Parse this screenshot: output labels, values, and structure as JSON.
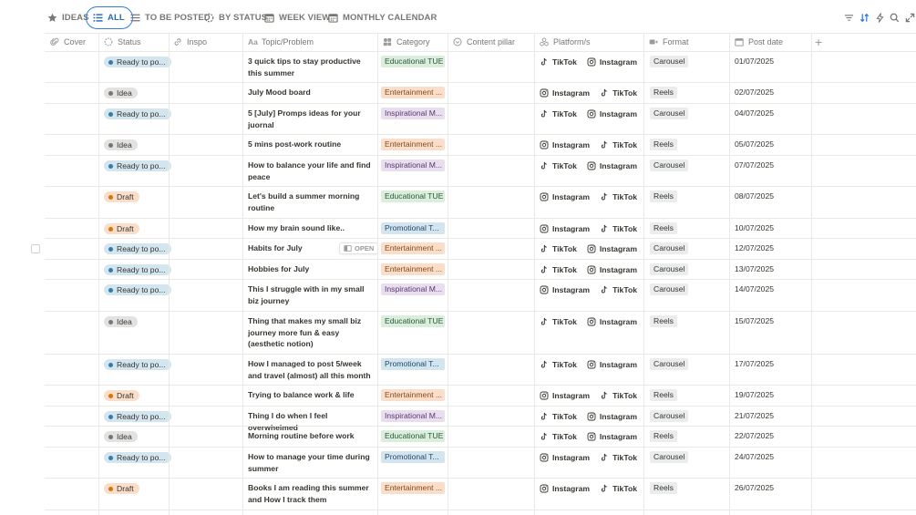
{
  "views": {
    "ideas": "IDEAS",
    "all": "ALL",
    "to_be_posted": "TO BE POSTED",
    "by_status": "BY STATUS",
    "week_view": "WEEK VIEW",
    "monthly_calendar": "MONTHLY CALENDAR"
  },
  "columns": {
    "cover": "Cover",
    "status": "Status",
    "inspo": "Inspo",
    "topic": "Topic/Problem",
    "category": "Category",
    "pillar": "Content pillar",
    "platforms": "Platform/s",
    "format": "Format",
    "post_date": "Post date"
  },
  "row_action": "OPEN",
  "colors": {
    "accent": "#2f80d8",
    "status_ready_bg": "#d3e5ef",
    "status_ready_dot": "#337ea9",
    "status_idea_bg": "#e3e2e0",
    "status_idea_dot": "#787774",
    "status_draft_bg": "#fadec9",
    "status_draft_dot": "#d9730d",
    "cat_educational": "#dbeddb",
    "cat_entertainment": "#fadec9",
    "cat_inspirational": "#e8deee",
    "cat_promotional": "#d3e5ef"
  },
  "rows": [
    {
      "status": "Ready to po...",
      "topic": "3 quick tips to stay productive this summer",
      "category": "Educational TUE",
      "platforms": [
        "TikTok",
        "Instagram"
      ],
      "format": "Carousel",
      "date": "01/07/2025"
    },
    {
      "status": "Idea",
      "topic": "July Mood board",
      "category": "Entertainment ...",
      "platforms": [
        "Instagram",
        "TikTok"
      ],
      "format": "Reels",
      "date": "02/07/2025"
    },
    {
      "status": "Ready to po...",
      "topic": "5 [July] Promps ideas for your juornal",
      "category": "Inspirational M...",
      "platforms": [
        "TikTok",
        "Instagram"
      ],
      "format": "Carousel",
      "date": "04/07/2025"
    },
    {
      "status": "Idea",
      "topic": "5 mins post-work routine",
      "category": "Entertainment ...",
      "platforms": [
        "Instagram",
        "TikTok"
      ],
      "format": "Reels",
      "date": "05/07/2025"
    },
    {
      "status": "Ready to po...",
      "topic": "How to balance your life and find peace",
      "category": "Inspirational M...",
      "platforms": [
        "TikTok",
        "Instagram"
      ],
      "format": "Carousel",
      "date": "07/07/2025"
    },
    {
      "status": "Draft",
      "topic": "Let's build a summer morning routine",
      "category": "Educational TUE",
      "platforms": [
        "Instagram",
        "TikTok"
      ],
      "format": "Reels",
      "date": "08/07/2025"
    },
    {
      "status": "Draft",
      "topic": "How my brain sound like..",
      "category": "Promotional T...",
      "platforms": [
        "Instagram",
        "TikTok"
      ],
      "format": "Reels",
      "date": "10/07/2025"
    },
    {
      "status": "Ready to po...",
      "topic": "Habits for July",
      "category": "Entertainment ...",
      "platforms": [
        "TikTok",
        "Instagram"
      ],
      "format": "Carousel",
      "date": "12/07/2025"
    },
    {
      "status": "Ready to po...",
      "topic": "Hobbies for July",
      "category": "Entertainment ...",
      "platforms": [
        "TikTok",
        "Instagram"
      ],
      "format": "Carousel",
      "date": "13/07/2025"
    },
    {
      "status": "Ready to po...",
      "topic": "This I struggle with in my small biz journey",
      "category": "Inspirational M...",
      "platforms": [
        "Instagram",
        "TikTok"
      ],
      "format": "Carousel",
      "date": "14/07/2025"
    },
    {
      "status": "Idea",
      "topic": "Thing that makes my small biz journey more fun & easy (aesthetic notion)",
      "category": "Educational TUE",
      "platforms": [
        "TikTok",
        "Instagram"
      ],
      "format": "Reels",
      "date": "15/07/2025"
    },
    {
      "status": "Ready to po...",
      "topic": "How I managed to post 5/week and travel (almost) all this month",
      "category": "Promotional T...",
      "platforms": [
        "TikTok",
        "Instagram"
      ],
      "format": "Carousel",
      "date": "17/07/2025"
    },
    {
      "status": "Draft",
      "topic": "Trying to balance work & life",
      "category": "Entertainment ...",
      "platforms": [
        "Instagram",
        "TikTok"
      ],
      "format": "Reels",
      "date": "19/07/2025"
    },
    {
      "status": "Ready to po...",
      "topic": "Thing I do when I feel overwhelmed",
      "category": "Inspirational M...",
      "platforms": [
        "TikTok",
        "Instagram"
      ],
      "format": "Carousel",
      "date": "21/07/2025"
    },
    {
      "status": "Idea",
      "topic": "Morning routine before work",
      "category": "Educational TUE",
      "platforms": [
        "TikTok",
        "Instagram"
      ],
      "format": "Reels",
      "date": "22/07/2025"
    },
    {
      "status": "Ready to po...",
      "topic": "How to manage your time during summer",
      "category": "Promotional T...",
      "platforms": [
        "Instagram",
        "TikTok"
      ],
      "format": "Carousel",
      "date": "24/07/2025"
    },
    {
      "status": "Draft",
      "topic": "Books I am reading this summer and How I track them",
      "category": "Entertainment ...",
      "platforms": [
        "Instagram",
        "TikTok"
      ],
      "format": "Reels",
      "date": "26/07/2025"
    }
  ]
}
